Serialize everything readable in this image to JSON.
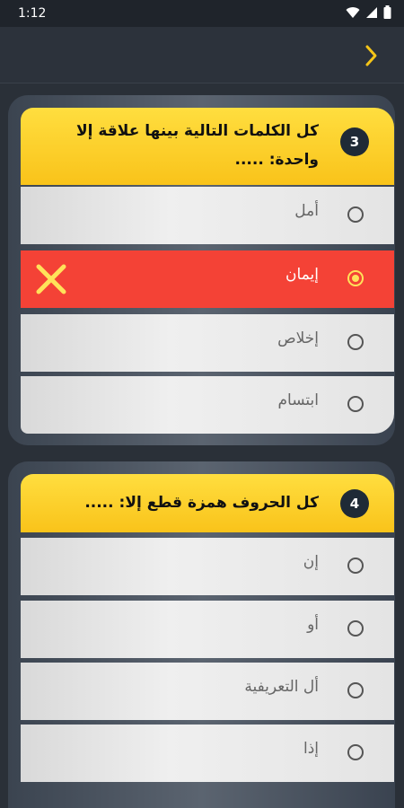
{
  "status": {
    "time": "1:12"
  },
  "app_bar": {
    "back_icon": "chevron-right-icon",
    "accent": "#f5c518"
  },
  "questions": [
    {
      "number": "3",
      "text": "كل الكلمات التالية بينها علاقة إلا واحدة: .....",
      "options": [
        {
          "label": "أمل",
          "state": "unselected"
        },
        {
          "label": "إيمان",
          "state": "selected-wrong"
        },
        {
          "label": "إخلاص",
          "state": "unselected"
        },
        {
          "label": "ابتسام",
          "state": "unselected"
        }
      ]
    },
    {
      "number": "4",
      "text": "كل الحروف همزة قطع إلا: .....",
      "options": [
        {
          "label": "إن",
          "state": "unselected"
        },
        {
          "label": "أو",
          "state": "unselected"
        },
        {
          "label": "أل التعريفية",
          "state": "unselected"
        },
        {
          "label": "إذا",
          "state": "unselected"
        }
      ]
    }
  ],
  "colors": {
    "header_yellow": "#fcd12a",
    "wrong_red": "#f44236",
    "radio_yellow": "#ffe25a"
  }
}
